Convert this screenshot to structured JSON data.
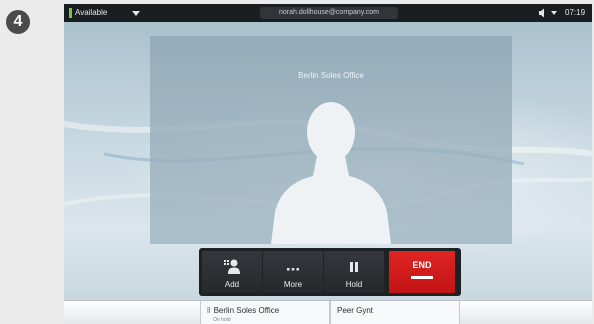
{
  "step_number": "4",
  "status_bar": {
    "presence": "Available",
    "presence_color": "#6fc94c",
    "user_email": "norah.dollhouse@company.com",
    "time": "07:19"
  },
  "video": {
    "caller_name": "Berlin Soles Office"
  },
  "controls": {
    "add_label": "Add",
    "more_label": "More",
    "hold_label": "Hold",
    "end_label": "END",
    "end_color": "#d81c1c"
  },
  "calls": [
    {
      "name": "Berlin Soles Office",
      "status": "On hold"
    },
    {
      "name": "Peer Gynt"
    }
  ]
}
